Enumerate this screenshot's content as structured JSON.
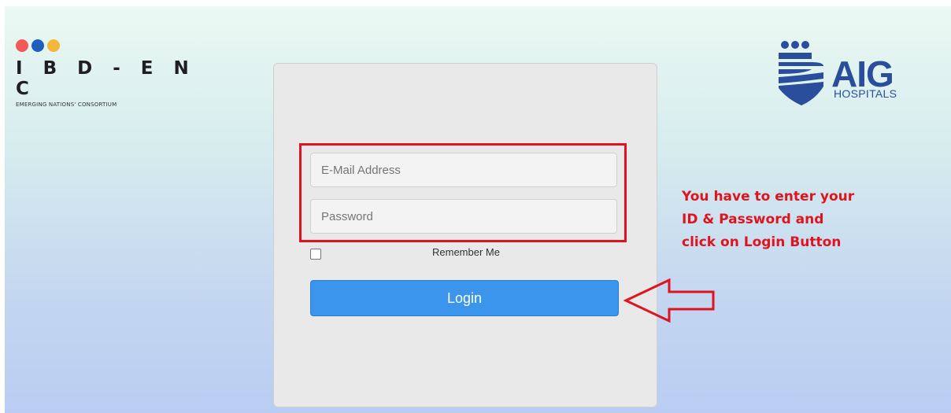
{
  "branding": {
    "left_logo": {
      "dots": [
        "#f25a5a",
        "#1f5fbf",
        "#f4b63c"
      ],
      "name": "I B D  - E N C",
      "subtitle": "EMERGING NATIONS' CONSORTIUM"
    },
    "right_logo": {
      "name": "AIG",
      "subtitle": "HOSPITALS",
      "color": "#2a4d9c"
    }
  },
  "login_form": {
    "email": {
      "value": "",
      "placeholder": "E-Mail Address"
    },
    "password": {
      "value": "",
      "placeholder": "Password"
    },
    "remember_me": {
      "label": "Remember Me",
      "checked": false
    },
    "login_button": {
      "label": "Login",
      "color": "#3b95ec"
    }
  },
  "annotation": {
    "lines": [
      "You have to enter your",
      "ID & Password and",
      "click on Login Button"
    ],
    "color": "#e0141e",
    "arrow_icon": "left-arrow-icon"
  }
}
